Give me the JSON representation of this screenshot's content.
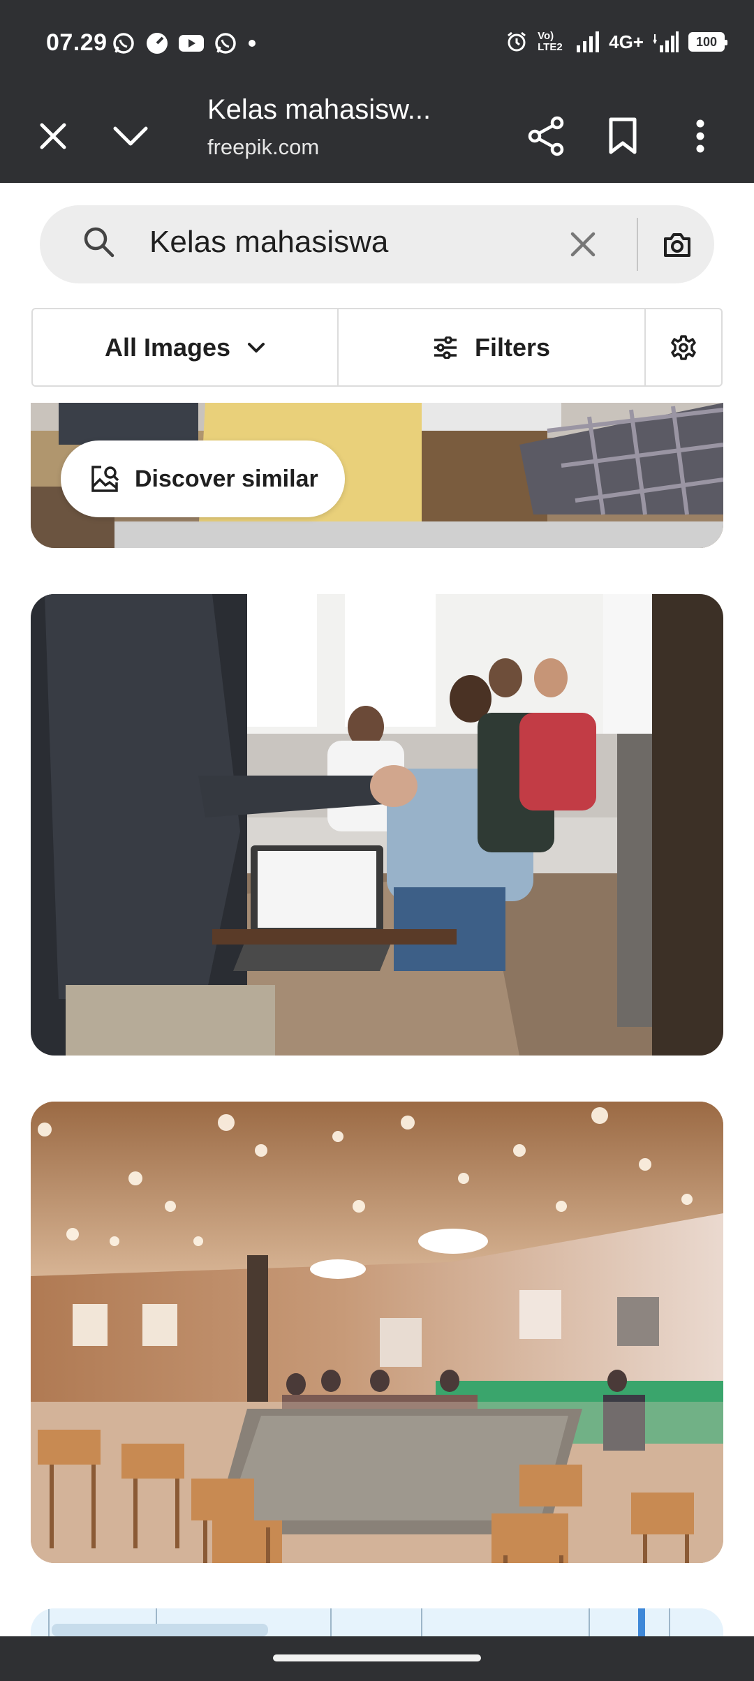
{
  "status_bar": {
    "time": "07.29",
    "left_icons": [
      "whatsapp-icon",
      "speed-icon",
      "youtube-icon",
      "whatsapp-icon",
      "dot-icon"
    ],
    "volte_label": "Vo) LTE2",
    "network": "4G+",
    "battery": "100"
  },
  "toolbar": {
    "title": "Kelas mahasisw...",
    "url": "freepik.com",
    "icons": [
      "close-icon",
      "chevron-down-icon",
      "share-icon",
      "bookmark-icon",
      "more-vert-icon"
    ]
  },
  "search": {
    "query": "Kelas mahasiswa"
  },
  "filter_row": {
    "all_images": "All Images",
    "filters": "Filters"
  },
  "results": {
    "discover_similar": "Discover similar"
  },
  "colors": {
    "chrome_dark": "#2f3033",
    "search_bg": "#ededed",
    "text_primary": "#1f1f1f"
  }
}
